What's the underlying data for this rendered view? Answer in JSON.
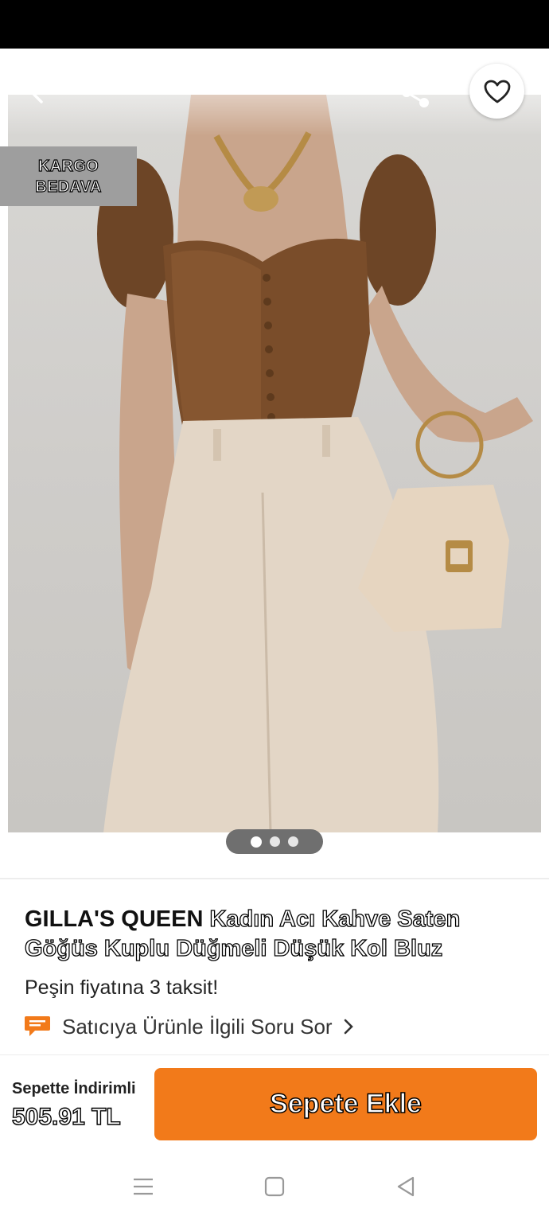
{
  "badge": {
    "line1": "KARGO",
    "line2": "BEDAVA"
  },
  "gallery": {
    "page_count": 3,
    "current_index": 0
  },
  "product": {
    "brand": "GILLA'S QUEEN",
    "name": "Kadın Acı Kahve Saten Göğüs Kuplu Düğmeli Düşük Kol Bluz",
    "installment": "Peşin fiyatına 3 taksit!",
    "ask_seller": "Satıcıya Ürünle İlgili Soru Sor"
  },
  "purchase": {
    "discount_label": "Sepette İndirimli",
    "price": "505.91 TL",
    "add_to_cart": "Sepete Ekle"
  },
  "colors": {
    "accent": "#f27a1a",
    "badge_bg": "#9e9e9e",
    "status_bar": "#000000"
  },
  "icons": {
    "back": "arrow-left-icon",
    "share": "share-icon",
    "favorite": "heart-outline-icon",
    "ask": "chat-bubble-icon",
    "chevron": "chevron-right-icon",
    "nav_menu": "menu-lines-icon",
    "nav_home": "square-icon",
    "nav_back": "triangle-back-icon"
  }
}
